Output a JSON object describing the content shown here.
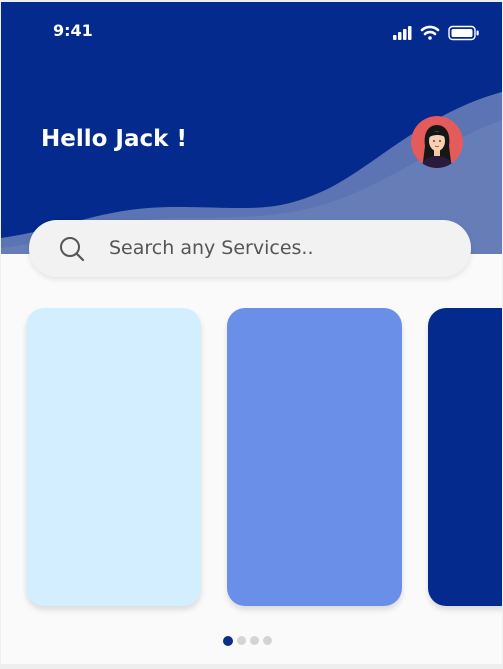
{
  "status_bar": {
    "time": "9:41",
    "icons": [
      "signal-icon",
      "wifi-icon",
      "battery-icon"
    ]
  },
  "header": {
    "greeting": "Hello Jack !",
    "avatar_icon": "user-avatar"
  },
  "search": {
    "placeholder": "Search any Services..",
    "icon": "search-icon"
  },
  "carousel": {
    "card_colors": [
      "#d3efff",
      "#6a8fe8",
      "#032a8c"
    ],
    "page_count": 4,
    "active_page": 1
  },
  "colors": {
    "primary": "#032a8c",
    "wave": "#5c74b3",
    "dot_active": "#0b2f86",
    "dot_inactive": "#d4d4d4"
  }
}
